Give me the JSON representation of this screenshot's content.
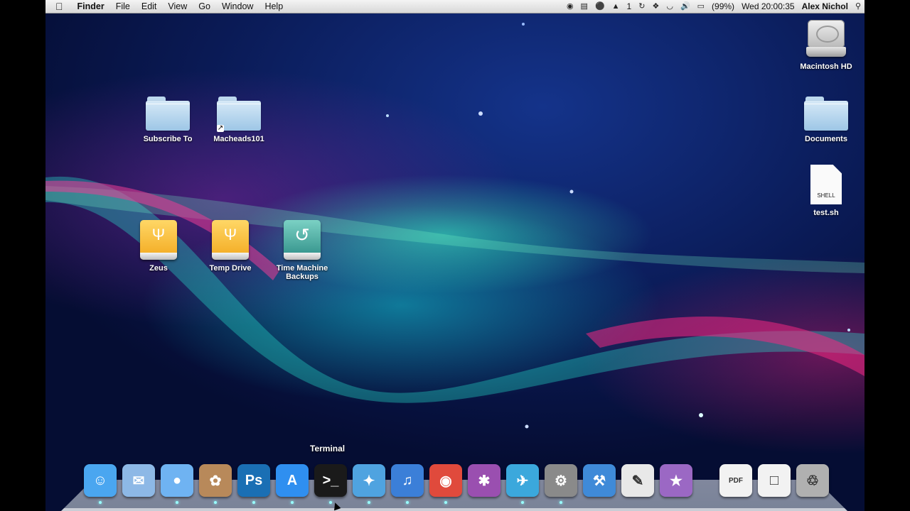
{
  "menubar": {
    "apple": "",
    "app_name": "Finder",
    "menus": [
      "File",
      "Edit",
      "View",
      "Go",
      "Window",
      "Help"
    ],
    "status": {
      "adobe_count": "1",
      "battery": "(99%)",
      "clock": "Wed 20:00:35",
      "user": "Alex Nichol"
    }
  },
  "desktop": {
    "subscribe_to": "Subscribe To",
    "macheads101": "Macheads101",
    "zeus": "Zeus",
    "temp_drive": "Temp Drive",
    "time_machine": "Time Machine Backups",
    "macintosh_hd": "Macintosh HD",
    "documents": "Documents",
    "test_sh": "test.sh",
    "test_sh_kind": "SHELL"
  },
  "dock": {
    "tooltip": "Terminal",
    "items": [
      {
        "name": "Finder",
        "color": "#4aa6f0"
      },
      {
        "name": "Mail",
        "color": "#8db8e6"
      },
      {
        "name": "FaceTime",
        "color": "#6fb3f2"
      },
      {
        "name": "Preview",
        "color": "#b8895a"
      },
      {
        "name": "Photoshop",
        "color": "#1a6fb4"
      },
      {
        "name": "App Store",
        "color": "#2f8ff0"
      },
      {
        "name": "Terminal",
        "color": "#1a1a1a"
      },
      {
        "name": "Safari",
        "color": "#4fa3e0"
      },
      {
        "name": "iTunes",
        "color": "#3b7fd8"
      },
      {
        "name": "Google Chrome",
        "color": "#e04a3c"
      },
      {
        "name": "Adobe Media Encoder",
        "color": "#9a4fb0"
      },
      {
        "name": "Twitter",
        "color": "#3ba8dc"
      },
      {
        "name": "System Preferences",
        "color": "#8a8a8a"
      },
      {
        "name": "Xcode",
        "color": "#3f8ad8"
      },
      {
        "name": "Script Editor",
        "color": "#e8e8e8"
      },
      {
        "name": "iMovie",
        "color": "#9b68c4"
      },
      {
        "name": "Documents Stack",
        "color": "#f2f2f2"
      },
      {
        "name": "Files Stack",
        "color": "#f2f2f2"
      },
      {
        "name": "Trash",
        "color": "#b0b0b0"
      }
    ],
    "photoshop_label": "Ps"
  }
}
